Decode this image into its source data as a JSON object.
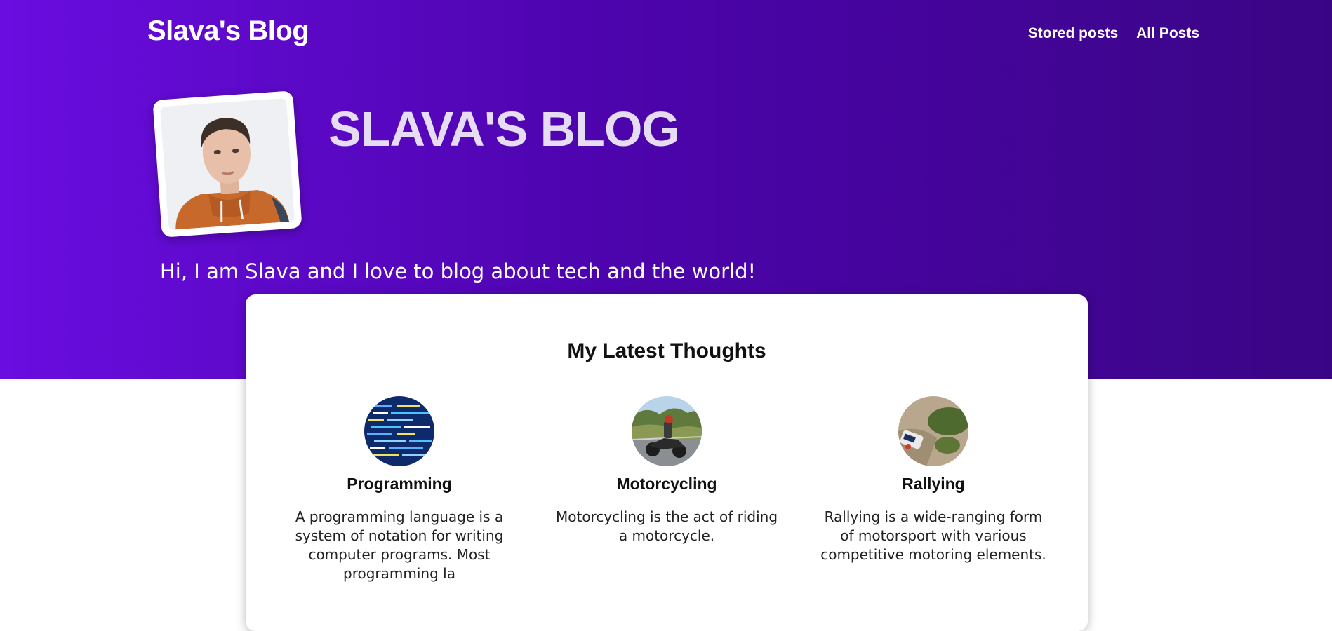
{
  "header": {
    "brand": "Slava's Blog",
    "nav": [
      "Stored posts",
      "All Posts"
    ]
  },
  "hero": {
    "title": "SLAVA'S BLOG",
    "subtitle": "Hi, I am Slava and I love to blog about tech and the world!",
    "avatar_alt": "portrait photo"
  },
  "latest": {
    "title": "My Latest Thoughts",
    "topics": [
      {
        "name": "Programming",
        "text": "A programming language is a system of notation for writing computer programs. Most programming la",
        "icon": "code-screen-image"
      },
      {
        "name": "Motorcycling",
        "text": "Motorcycling is the act of riding a motorcycle.",
        "icon": "motorcycle-image"
      },
      {
        "name": "Rallying",
        "text": "Rallying is a wide-ranging form of motorsport with various competitive motoring elements.",
        "icon": "rally-car-image"
      }
    ]
  },
  "colors": {
    "hero_start": "#6a0de0",
    "hero_end": "#3a0585",
    "hero_title": "#e6dcf3"
  }
}
